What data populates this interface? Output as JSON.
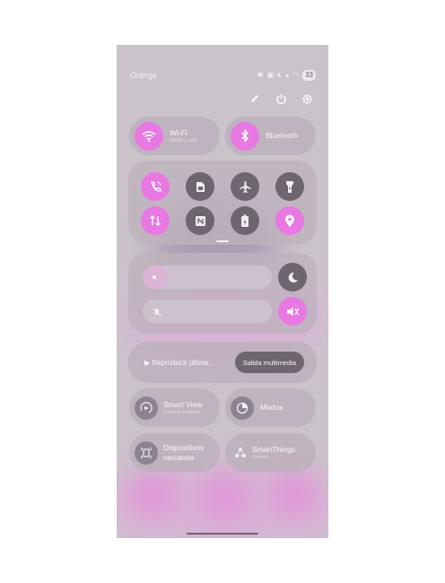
{
  "status_bar": {
    "carrier": "Orange",
    "icons": [
      "bluetooth-icon",
      "nfc-icon",
      "mute-icon",
      "signal-icon",
      "wifi-icon"
    ],
    "battery": "33"
  },
  "toolbar": {
    "icons": [
      "edit-icon",
      "power-icon",
      "settings-icon"
    ]
  },
  "tiles": {
    "wifi": {
      "label": "Wi-Fi",
      "sublabel": "MiWiFi_cdzh",
      "state": "on"
    },
    "bluetooth": {
      "label": "Bluetooth",
      "state": "on"
    }
  },
  "grid": [
    {
      "icon": "wifi-calling-icon",
      "state": "on"
    },
    {
      "icon": "sim-icon",
      "state": "off"
    },
    {
      "icon": "airplane-icon",
      "state": "off"
    },
    {
      "icon": "flashlight-icon",
      "state": "off"
    },
    {
      "icon": "mobile-data-icon",
      "state": "on"
    },
    {
      "icon": "nfc-icon",
      "state": "off"
    },
    {
      "icon": "battery-saver-icon",
      "state": "off"
    },
    {
      "icon": "location-icon",
      "state": "on"
    }
  ],
  "media": {
    "play_label": "▶ Reproducir última...",
    "output_label": "Salida multimedia"
  },
  "smart_view": {
    "label": "Smart View",
    "sublabel": "Duplicar pantalla"
  },
  "modes": {
    "label": "Modos"
  },
  "nearby": {
    "label_line1": "Dispositivos",
    "label_line2": "cercanos"
  },
  "smartthings": {
    "label": "SmartThings",
    "sublabel": "Control"
  },
  "colors": {
    "accent": "#e878e2",
    "tile_off": "#6e6570",
    "background": "#cbc3ca"
  }
}
